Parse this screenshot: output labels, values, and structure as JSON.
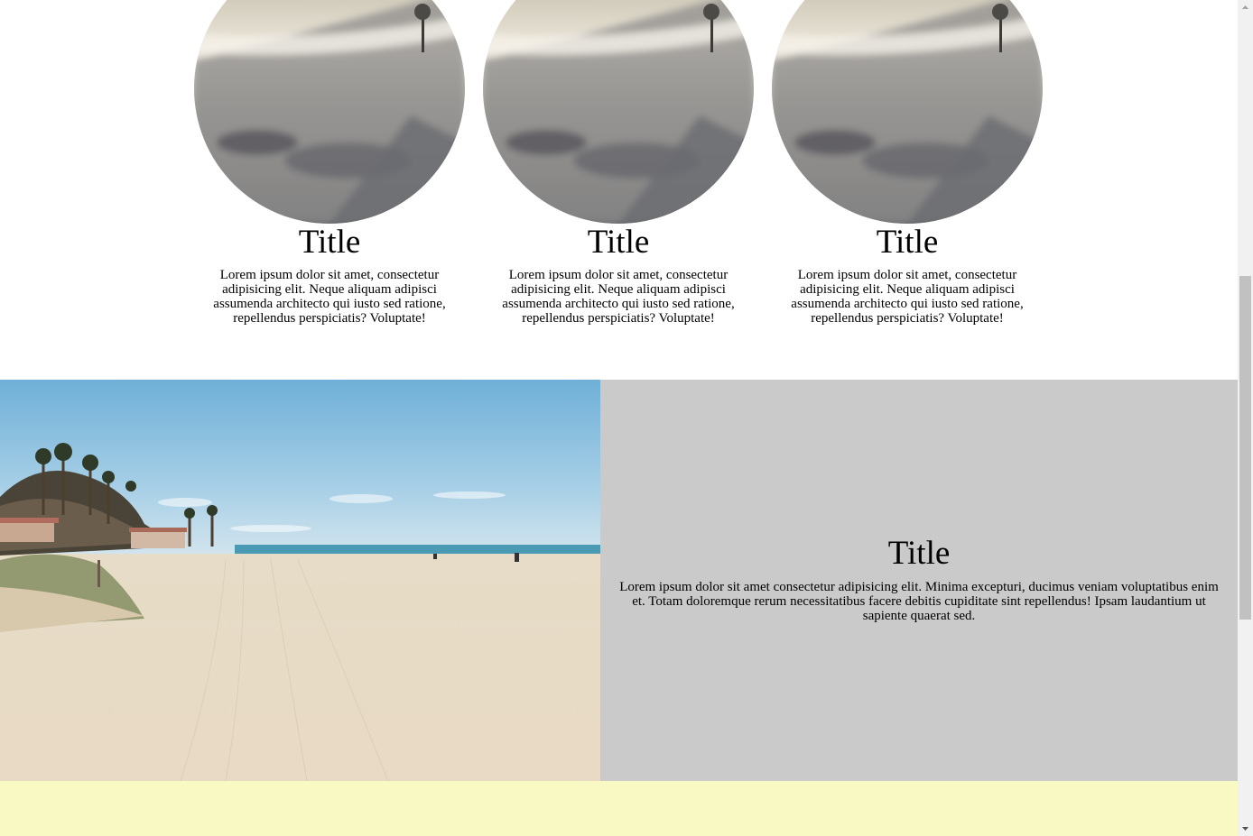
{
  "cards": [
    {
      "title": "Title",
      "text": "Lorem ipsum dolor sit amet, consectetur adipisicing elit. Neque aliquam adipisci assumenda architecto qui iusto sed ratione, repellendus perspiciatis? Voluptate!",
      "image_icon": "beach-photo"
    },
    {
      "title": "Title",
      "text": "Lorem ipsum dolor sit amet, consectetur adipisicing elit. Neque aliquam adipisci assumenda architecto qui iusto sed ratione, repellendus perspiciatis? Voluptate!",
      "image_icon": "beach-photo"
    },
    {
      "title": "Title",
      "text": "Lorem ipsum dolor sit amet, consectetur adipisicing elit. Neque aliquam adipisci assumenda architecto qui iusto sed ratione, repellendus perspiciatis? Voluptate!",
      "image_icon": "beach-photo"
    }
  ],
  "feature": {
    "title": "Title",
    "text": "Lorem ipsum dolor sit amet consectetur adipisicing elit. Minima excepturi, ducimus veniam voluptatibus enim et. Totam doloremque rerum necessitatibus facere debitis cupiditate sint repellendus! Ipsam laudantium ut sapiente quaerat sed.",
    "image_icon": "beach-photo",
    "background_color": "#cacaca"
  },
  "bottom_section": {
    "background_color": "#f9f9c4"
  },
  "scrollbar": {
    "position": 0.55
  }
}
